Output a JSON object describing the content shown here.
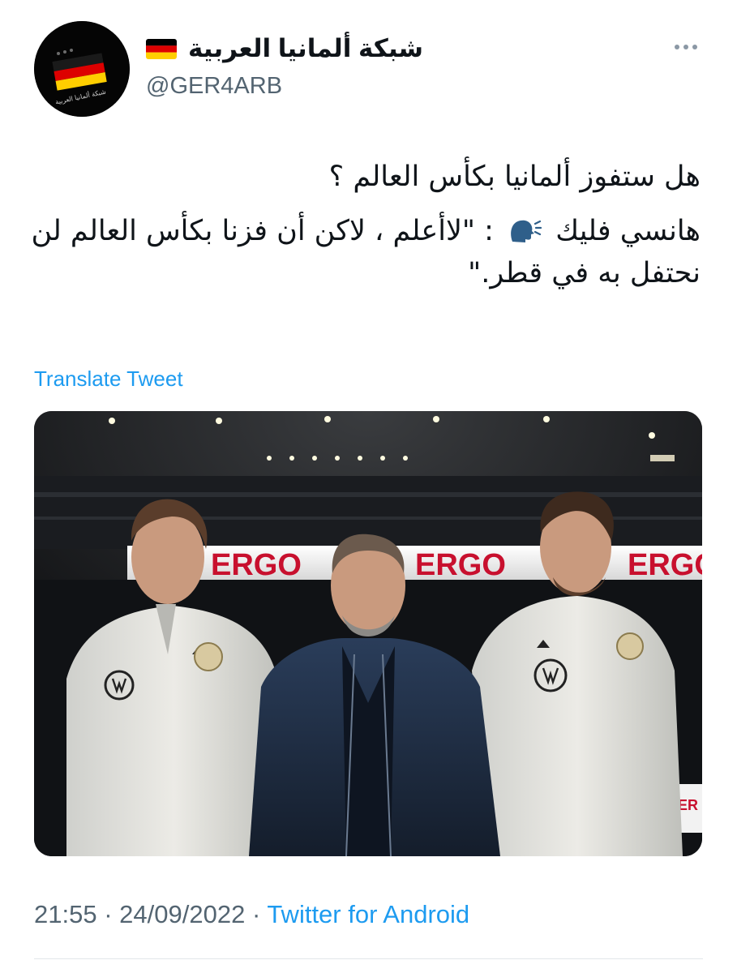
{
  "author": {
    "display_name": "شبكة ألمانيا العربية",
    "handle": "@GER4ARB",
    "flag_emoji": "german-flag-icon",
    "avatar_text": "شبكة ألمانيا العربية"
  },
  "tweet": {
    "line1": "هل ستفوز ألمانيا بكأس العالم ؟",
    "line2_prefix": "هانسي فليك",
    "line2_rest": ": \"لاأعلم ، لاكن أن فزنا بكأس العالم لن نحتفل به في قطر.\"",
    "speaking_icon": "speaking-head-icon"
  },
  "translate_label": "Translate Tweet",
  "media": {
    "banner_text": [
      "ERGO",
      "ERGO",
      "ERGO"
    ],
    "side_banner_text": "ER"
  },
  "meta": {
    "time": "21:55",
    "separator": "·",
    "date": "24/09/2022",
    "source": "Twitter for Android"
  },
  "colors": {
    "link": "#1d9bf0",
    "muted": "#536471",
    "text": "#0f1419"
  }
}
